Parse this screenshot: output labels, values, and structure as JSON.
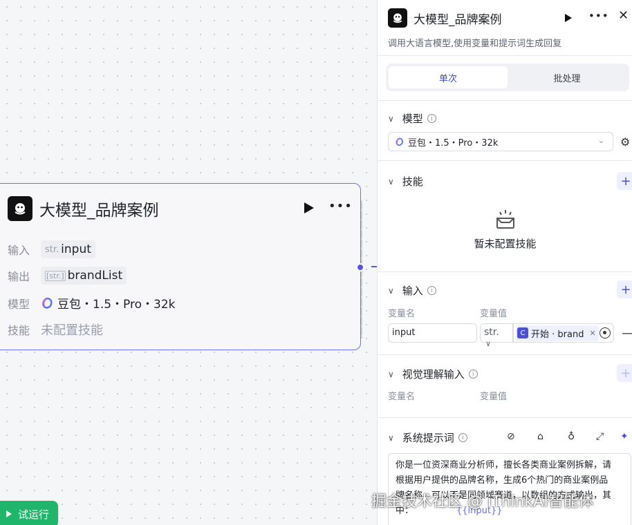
{
  "node": {
    "title": "大模型_品牌案例",
    "rows": {
      "input": {
        "label": "输入",
        "type": "str.",
        "value": "input"
      },
      "output": {
        "label": "输出",
        "type": "[str.]",
        "value": "brandList"
      },
      "model": {
        "label": "模型",
        "value": "豆包・1.5・Pro・32k"
      },
      "skill": {
        "label": "技能",
        "value": "未配置技能"
      }
    }
  },
  "test_run": {
    "label": "试运行"
  },
  "panel": {
    "title": "大模型_品牌案例",
    "description": "调用大语言模型,使用变量和提示词生成回复",
    "tabs": [
      {
        "label": "单次",
        "active": true
      },
      {
        "label": "批处理",
        "active": false
      }
    ],
    "model_section": {
      "title": "模型",
      "selected": "豆包・1.5・Pro・32k"
    },
    "skill_section": {
      "title": "技能",
      "empty_text": "暂未配置技能"
    },
    "input_section": {
      "title": "输入",
      "col_name": "变量名",
      "col_value": "变量值",
      "row": {
        "name": "input",
        "type": "str.",
        "ref": "开始 · brand"
      }
    },
    "vision_section": {
      "title": "视觉理解输入",
      "col_name": "变量名",
      "col_value": "变量值"
    },
    "prompt_section": {
      "title": "系统提示词",
      "line1": "你是一位资深商业分析师，擅长各类商业案例拆解，请",
      "line2": "根据用户提供的品牌名称，生成6个热门的商业案例品",
      "line3": "牌名称，可以不是同领域赛道，以数组的方式输出，其",
      "line4_pre": "中：",
      "line4_var": "{{input}}"
    }
  },
  "watermark": "掘金技术社区 @ iThinkAI智能体",
  "colors": {
    "accent": "#5456e8",
    "run_green": "#1fb56a",
    "node_border": "#6b6ff0"
  }
}
